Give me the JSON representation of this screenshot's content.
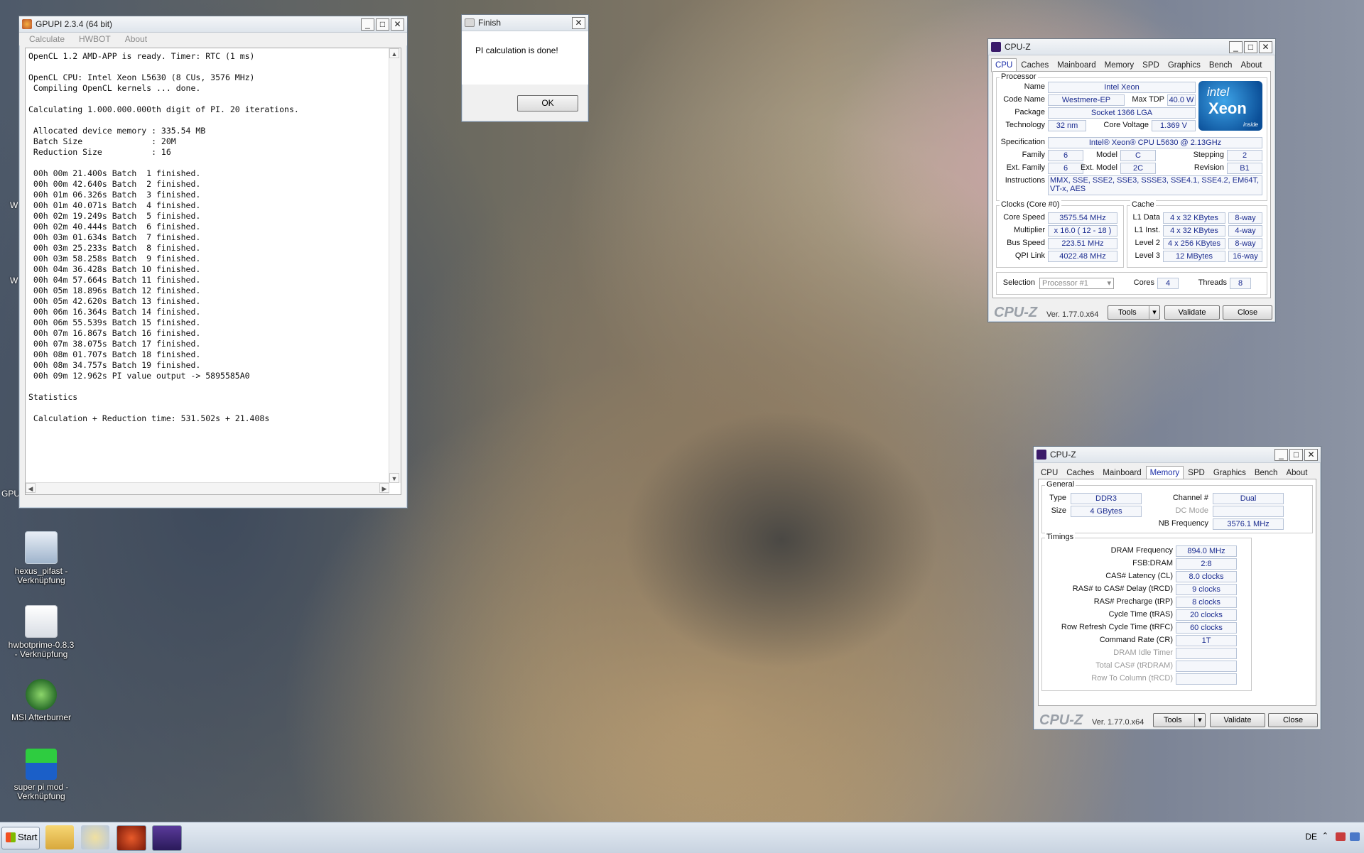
{
  "gpupi": {
    "title": "GPUPI 2.3.4 (64 bit)",
    "menu": [
      "Calculate",
      "HWBOT",
      "About"
    ],
    "output": "OpenCL 1.2 AMD-APP is ready. Timer: RTC (1 ms)\n\nOpenCL CPU: Intel Xeon L5630 (8 CUs, 3576 MHz)\n Compiling OpenCL kernels ... done.\n\nCalculating 1.000.000.000th digit of PI. 20 iterations.\n\n Allocated device memory : 335.54 MB\n Batch Size              : 20M\n Reduction Size          : 16\n\n 00h 00m 21.400s Batch  1 finished.\n 00h 00m 42.640s Batch  2 finished.\n 00h 01m 06.326s Batch  3 finished.\n 00h 01m 40.071s Batch  4 finished.\n 00h 02m 19.249s Batch  5 finished.\n 00h 02m 40.444s Batch  6 finished.\n 00h 03m 01.634s Batch  7 finished.\n 00h 03m 25.233s Batch  8 finished.\n 00h 03m 58.258s Batch  9 finished.\n 00h 04m 36.428s Batch 10 finished.\n 00h 04m 57.664s Batch 11 finished.\n 00h 05m 18.896s Batch 12 finished.\n 00h 05m 42.620s Batch 13 finished.\n 00h 06m 16.364s Batch 14 finished.\n 00h 06m 55.539s Batch 15 finished.\n 00h 07m 16.867s Batch 16 finished.\n 00h 07m 38.075s Batch 17 finished.\n 00h 08m 01.707s Batch 18 finished.\n 00h 08m 34.757s Batch 19 finished.\n 00h 09m 12.962s PI value output -> 5895585A0\n\nStatistics\n\n Calculation + Reduction time: 531.502s + 21.408s"
  },
  "finish": {
    "title": "Finish",
    "message": "PI calculation is done!",
    "ok": "OK"
  },
  "cpuz_cpu": {
    "title": "CPU-Z",
    "tabs": [
      "CPU",
      "Caches",
      "Mainboard",
      "Memory",
      "SPD",
      "Graphics",
      "Bench",
      "About"
    ],
    "processor_label": "Processor",
    "name_l": "Name",
    "name": "Intel Xeon",
    "codename_l": "Code Name",
    "codename": "Westmere-EP",
    "maxtdp_l": "Max TDP",
    "maxtdp": "40.0 W",
    "package_l": "Package",
    "package": "Socket 1366 LGA",
    "tech_l": "Technology",
    "tech": "32 nm",
    "cv_l": "Core Voltage",
    "cv": "1.369 V",
    "spec_l": "Specification",
    "spec": "Intel® Xeon® CPU        L5630  @ 2.13GHz",
    "family_l": "Family",
    "family": "6",
    "model_l": "Model",
    "model": "C",
    "stepping_l": "Stepping",
    "stepping": "2",
    "extfam_l": "Ext. Family",
    "extfam": "6",
    "extmod_l": "Ext. Model",
    "extmod": "2C",
    "rev_l": "Revision",
    "rev": "B1",
    "instr_l": "Instructions",
    "instr": "MMX, SSE, SSE2, SSE3, SSSE3, SSE4.1, SSE4.2, EM64T, VT-x, AES",
    "logo1": "intel",
    "logo2": "Xeon",
    "logo3": "inside",
    "clocks_label": "Clocks (Core #0)",
    "cs_l": "Core Speed",
    "cs": "3575.54 MHz",
    "mult_l": "Multiplier",
    "mult": "x 16.0 ( 12 - 18 )",
    "bus_l": "Bus Speed",
    "bus": "223.51 MHz",
    "qpi_l": "QPI Link",
    "qpi": "4022.48 MHz",
    "cache_label": "Cache",
    "l1d_l": "L1 Data",
    "l1d": "4 x 32 KBytes",
    "l1d_w": "8-way",
    "l1i_l": "L1 Inst.",
    "l1i": "4 x 32 KBytes",
    "l1i_w": "4-way",
    "l2_l": "Level 2",
    "l2": "4 x 256 KBytes",
    "l2_w": "8-way",
    "l3_l": "Level 3",
    "l3": "12 MBytes",
    "l3_w": "16-way",
    "sel_l": "Selection",
    "sel": "Processor #1",
    "cores_l": "Cores",
    "cores": "4",
    "threads_l": "Threads",
    "threads": "8",
    "brand": "CPU-Z",
    "version": "Ver. 1.77.0.x64",
    "tools": "Tools",
    "validate": "Validate",
    "close": "Close"
  },
  "cpuz_mem": {
    "title": "CPU-Z",
    "tabs": [
      "CPU",
      "Caches",
      "Mainboard",
      "Memory",
      "SPD",
      "Graphics",
      "Bench",
      "About"
    ],
    "general_label": "General",
    "type_l": "Type",
    "type": "DDR3",
    "size_l": "Size",
    "size": "4 GBytes",
    "chan_l": "Channel #",
    "chan": "Dual",
    "dc_l": "DC Mode",
    "nb_l": "NB Frequency",
    "nb": "3576.1 MHz",
    "timings_label": "Timings",
    "timings": [
      {
        "label": "DRAM Frequency",
        "value": "894.0 MHz",
        "dis": false
      },
      {
        "label": "FSB:DRAM",
        "value": "2:8",
        "dis": false
      },
      {
        "label": "CAS# Latency (CL)",
        "value": "8.0 clocks",
        "dis": false
      },
      {
        "label": "RAS# to CAS# Delay (tRCD)",
        "value": "9 clocks",
        "dis": false
      },
      {
        "label": "RAS# Precharge (tRP)",
        "value": "8 clocks",
        "dis": false
      },
      {
        "label": "Cycle Time (tRAS)",
        "value": "20 clocks",
        "dis": false
      },
      {
        "label": "Row Refresh Cycle Time (tRFC)",
        "value": "60 clocks",
        "dis": false
      },
      {
        "label": "Command Rate (CR)",
        "value": "1T",
        "dis": false
      },
      {
        "label": "DRAM Idle Timer",
        "value": "",
        "dis": true
      },
      {
        "label": "Total CAS# (tRDRAM)",
        "value": "",
        "dis": true
      },
      {
        "label": "Row To Column (tRCD)",
        "value": "",
        "dis": true
      }
    ],
    "brand": "CPU-Z",
    "version": "Ver. 1.77.0.x64",
    "tools": "Tools",
    "validate": "Validate",
    "close": "Close"
  },
  "desktop_icons": [
    {
      "label": "hexus_pifast - Verknüpfung",
      "icon": "pifast-shortcut-icon"
    },
    {
      "label": "hwbotprime-0.8.3 - Verknüpfung",
      "icon": "java-shortcut-icon"
    },
    {
      "label": "MSI Afterburner",
      "icon": "afterburner-icon"
    },
    {
      "label": "super pi mod - Verknüpfung",
      "icon": "superpi-icon"
    }
  ],
  "desktop_fragments": [
    "W",
    "W",
    "GPU"
  ],
  "taskbar": {
    "start": "Start",
    "lang": "DE",
    "apps": [
      "explorer-icon",
      "paint-icon",
      "gpupi-icon",
      "cpuz-icon"
    ]
  }
}
